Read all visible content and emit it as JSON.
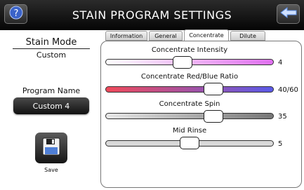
{
  "header": {
    "title": "STAIN PROGRAM SETTINGS"
  },
  "left": {
    "stain_mode_label": "Stain Mode",
    "stain_mode_value": "Custom",
    "program_name_label": "Program Name",
    "program_name_value": "Custom 4",
    "save_label": "Save"
  },
  "tabs": [
    {
      "label": "Information"
    },
    {
      "label": "General"
    },
    {
      "label": "Concentrate"
    },
    {
      "label": "Dilute"
    }
  ],
  "active_tab": "Concentrate",
  "sliders": [
    {
      "label": "Concentrate Intensity",
      "value": "4",
      "fraction": 0.46,
      "track_colors": [
        "#ffffff",
        "#e070f0"
      ]
    },
    {
      "label": "Concentrate Red/Blue Ratio",
      "value": "40/60",
      "fraction": 0.64,
      "track_colors": [
        "#f04a5a",
        "#5a5ae8"
      ]
    },
    {
      "label": "Concentrate Spin",
      "value": "35",
      "fraction": 0.64,
      "track_colors": [
        "#e8e8e8",
        "#777777"
      ]
    },
    {
      "label": "Mid Rinse",
      "value": "5",
      "fraction": 0.5,
      "track_colors": [
        "#d8d8d8",
        "#d8d8d8"
      ]
    }
  ],
  "icons": {
    "help": "help-question-icon",
    "back": "back-arrow-icon",
    "save": "floppy-disk-icon"
  }
}
